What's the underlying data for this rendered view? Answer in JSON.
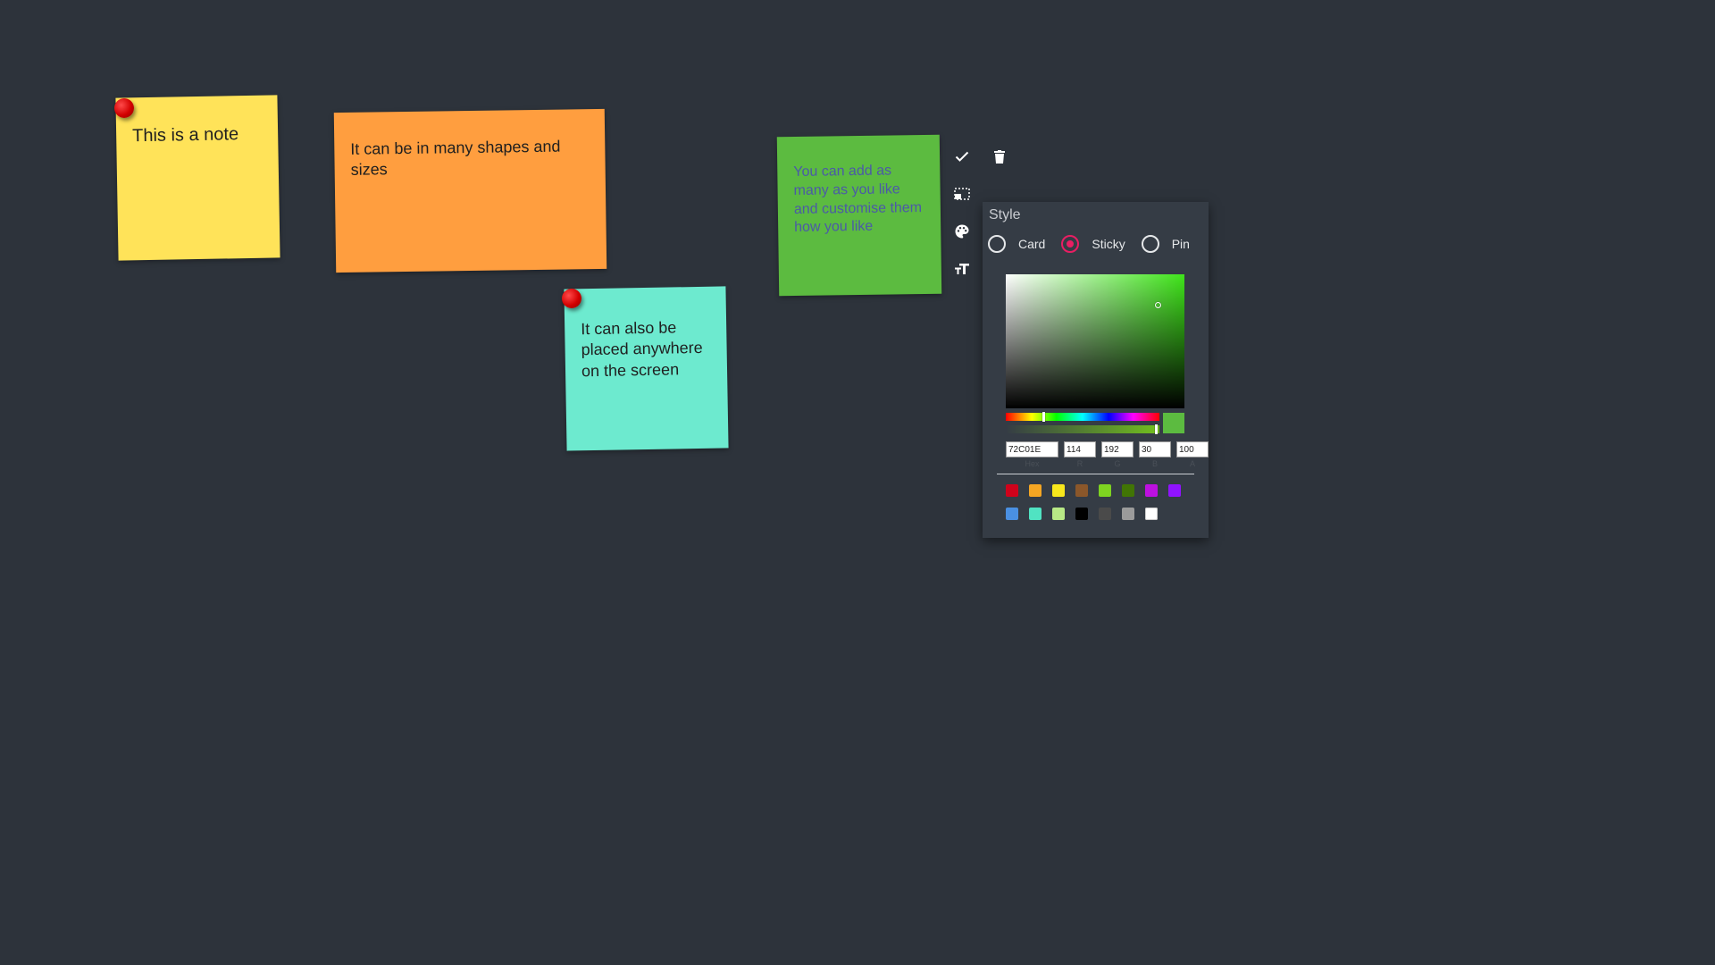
{
  "notes": [
    {
      "text": "This is a note",
      "color": "#ffe359",
      "style": "pin"
    },
    {
      "text": "It can be in many shapes and sizes",
      "color": "#ff9e3f",
      "style": "sticky"
    },
    {
      "text": "It can also be placed anywhere on the screen",
      "color": "#6deacf",
      "style": "pin"
    },
    {
      "text": "You can add as many as you like and customise them how you like",
      "color": "#5cbb40",
      "text_color": "#4b5aa7",
      "style": "sticky"
    }
  ],
  "toolbar": {
    "icons": [
      "check-icon",
      "trash-icon",
      "resize-icon",
      "palette-icon",
      "text-size-icon"
    ]
  },
  "style_panel": {
    "title": "Style",
    "options": [
      {
        "label": "Card",
        "checked": false
      },
      {
        "label": "Sticky",
        "checked": true
      },
      {
        "label": "Pin",
        "checked": false
      }
    ]
  },
  "color_picker": {
    "hex": "72C01E",
    "r": "114",
    "g": "192",
    "b": "30",
    "a": "100",
    "labels": {
      "hex": "Hex",
      "r": "R",
      "g": "G",
      "b": "B",
      "a": "A"
    },
    "preview_color": "#5cbb40",
    "hue_color": "#3fe41a",
    "presets": [
      "#d0021b",
      "#f5a623",
      "#f8e71c",
      "#8b572a",
      "#7ed321",
      "#417505",
      "#bd10e0",
      "#9013fe",
      "#4a90e2",
      "#50e3c2",
      "#b8e986",
      "#000000",
      "#4a4a4a",
      "#9b9b9b",
      "#ffffff"
    ]
  }
}
